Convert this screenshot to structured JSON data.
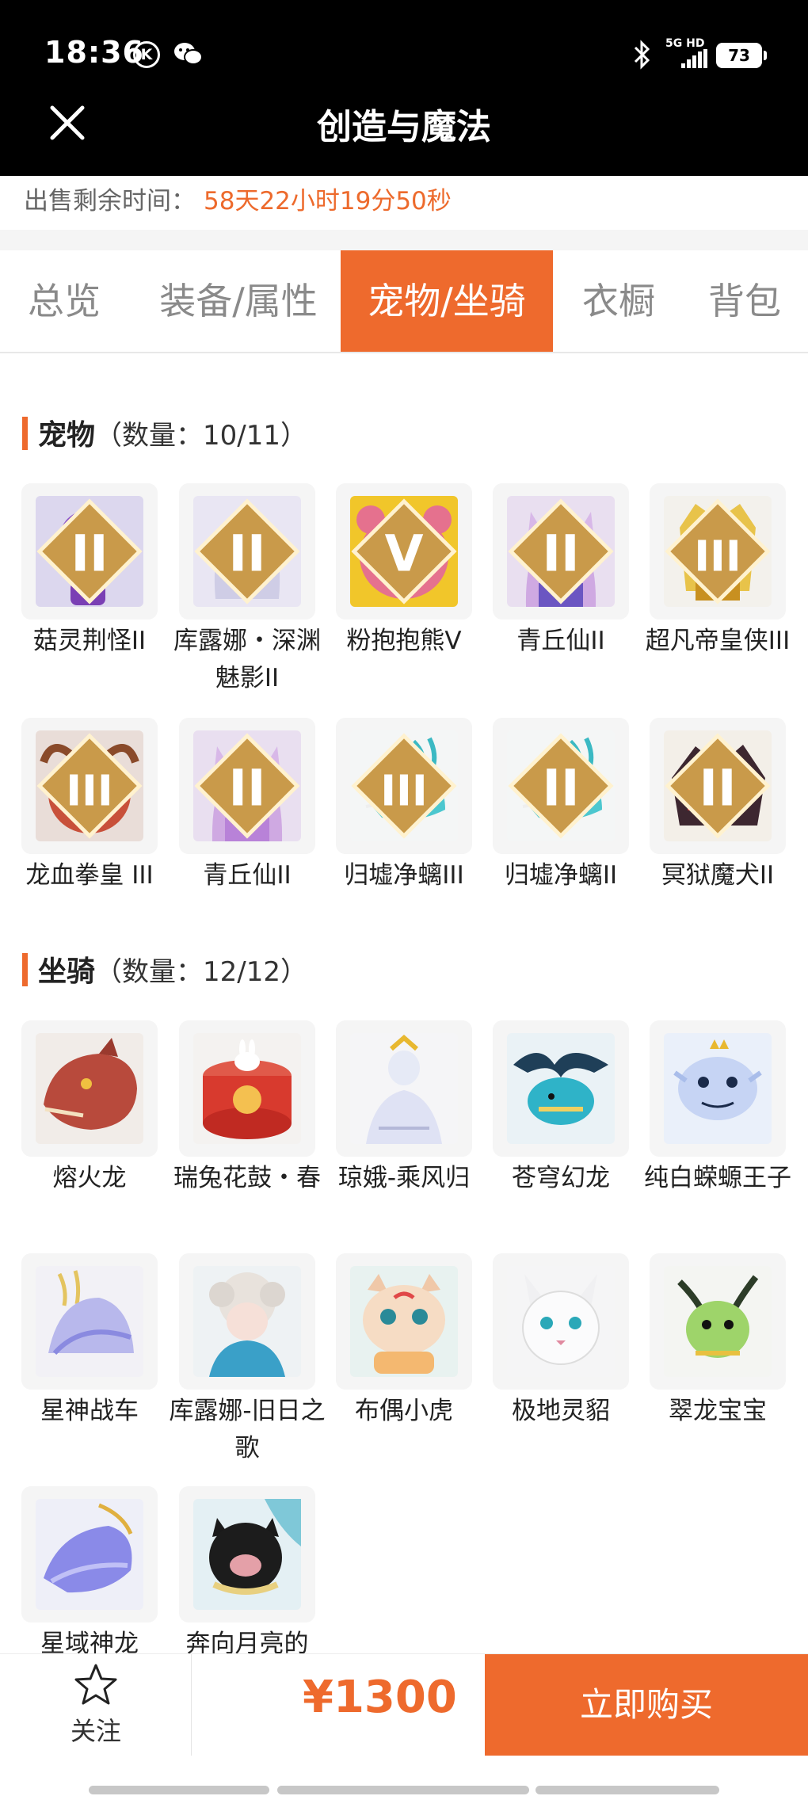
{
  "status_bar": {
    "time": "18:36",
    "network": "5G HD",
    "battery": "73"
  },
  "header": {
    "title": "创造与魔法"
  },
  "sale": {
    "label": "出售剩余时间：",
    "remaining": "58天22小时19分50秒"
  },
  "tabs": [
    {
      "label": "总览",
      "active": false
    },
    {
      "label": "装备/属性",
      "active": false
    },
    {
      "label": "宠物/坐骑",
      "active": true
    },
    {
      "label": "衣橱",
      "active": false
    },
    {
      "label": "背包",
      "active": false
    }
  ],
  "pets": {
    "title": "宠物",
    "count_label": "（数量：10/11）",
    "items": [
      {
        "label": "菇灵荆怪II",
        "tier": "II",
        "icon": "mushroom-sprite-icon"
      },
      {
        "label": "库露娜・深渊魅影II",
        "tier": "II",
        "icon": "abyss-phantom-icon"
      },
      {
        "label": "粉抱抱熊Ⅴ",
        "tier": "Ⅴ",
        "icon": "pink-bear-icon"
      },
      {
        "label": "青丘仙II",
        "tier": "II",
        "icon": "fox-fairy-icon"
      },
      {
        "label": "超凡帝皇侠III",
        "tier": "III",
        "icon": "emperor-hero-icon"
      },
      {
        "label": "龙血拳皇 III",
        "tier": "III",
        "icon": "dragon-blood-boxer-icon"
      },
      {
        "label": "青丘仙II",
        "tier": "II",
        "icon": "fox-fairy-icon"
      },
      {
        "label": "归墟净螭III",
        "tier": "III",
        "icon": "cyan-dragon-icon"
      },
      {
        "label": "归墟净螭II",
        "tier": "II",
        "icon": "cyan-dragon-icon"
      },
      {
        "label": "冥狱魔犬II",
        "tier": "II",
        "icon": "hell-hound-icon"
      }
    ]
  },
  "mounts": {
    "title": "坐骑",
    "count_label": "（数量：12/12）",
    "items": [
      {
        "label": "熔火龙",
        "icon": "lava-dragon-icon"
      },
      {
        "label": "瑞兔花鼓・春",
        "icon": "rabbit-drum-icon"
      },
      {
        "label": "琼娥-乘风归",
        "icon": "moon-maiden-icon"
      },
      {
        "label": "苍穹幻龙",
        "icon": "sky-dragon-icon"
      },
      {
        "label": "纯白蝾螈王子",
        "icon": "white-axolotl-icon"
      },
      {
        "label": "星神战车",
        "icon": "star-chariot-icon"
      },
      {
        "label": "库露娜-旧日之歌",
        "icon": "old-song-icon"
      },
      {
        "label": "布偶小虎",
        "icon": "plush-tiger-icon"
      },
      {
        "label": "极地灵貂",
        "icon": "polar-mink-icon"
      },
      {
        "label": "翠龙宝宝",
        "icon": "green-dragon-baby-icon"
      },
      {
        "label": "星域神龙",
        "icon": "star-dragon-icon"
      },
      {
        "label": "奔向月亮的",
        "icon": "moon-pig-icon"
      }
    ]
  },
  "bottom_bar": {
    "follow_label": "关注",
    "price": "¥1300",
    "buy_label": "立即购买"
  },
  "colors": {
    "accent": "#ee6a2d",
    "header_bg": "#000000",
    "card_bg": "#f5f5f5"
  }
}
